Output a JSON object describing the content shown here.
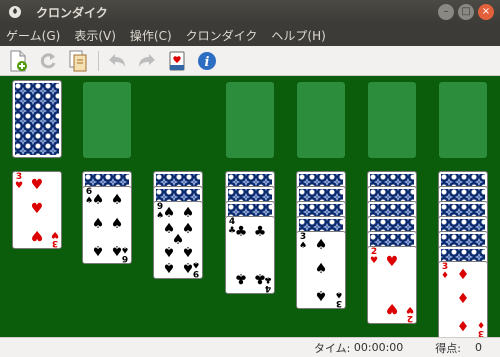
{
  "window": {
    "title": "クロンダイク"
  },
  "menu": {
    "items": [
      "ゲーム(G)",
      "表示(V)",
      "操作(C)",
      "クロンダイク",
      "ヘルプ(H)"
    ]
  },
  "toolbar": {
    "icons": [
      "new-game-icon",
      "restart-icon",
      "select-game-icon",
      "undo-icon",
      "redo-icon",
      "hint-icon",
      "info-icon"
    ]
  },
  "colors": {
    "felt": "#0b5c0b",
    "empty_slot": "#2c8d3c",
    "card_back": "#0b2a6e",
    "red_suit": "#dd0000"
  },
  "game": {
    "stock": {
      "face_down": true
    },
    "foundations": 4,
    "tableau": [
      {
        "face_down": 0,
        "face_up": [
          {
            "rank": "3",
            "suit": "♥",
            "color": "red"
          }
        ]
      },
      {
        "face_down": 1,
        "face_up": [
          {
            "rank": "6",
            "suit": "♠",
            "color": "black"
          }
        ]
      },
      {
        "face_down": 2,
        "face_up": [
          {
            "rank": "9",
            "suit": "♠",
            "color": "black"
          }
        ]
      },
      {
        "face_down": 3,
        "face_up": [
          {
            "rank": "4",
            "suit": "♣",
            "color": "black"
          }
        ]
      },
      {
        "face_down": 4,
        "face_up": [
          {
            "rank": "3",
            "suit": "♠",
            "color": "black"
          }
        ]
      },
      {
        "face_down": 5,
        "face_up": [
          {
            "rank": "2",
            "suit": "♥",
            "color": "red"
          }
        ]
      },
      {
        "face_down": 6,
        "face_up": [
          {
            "rank": "3",
            "suit": "♦",
            "color": "red"
          }
        ]
      }
    ]
  },
  "status": {
    "time_label": "タイム:",
    "time_value": "00:00:00",
    "score_label": "得点:",
    "score_value": "0"
  }
}
